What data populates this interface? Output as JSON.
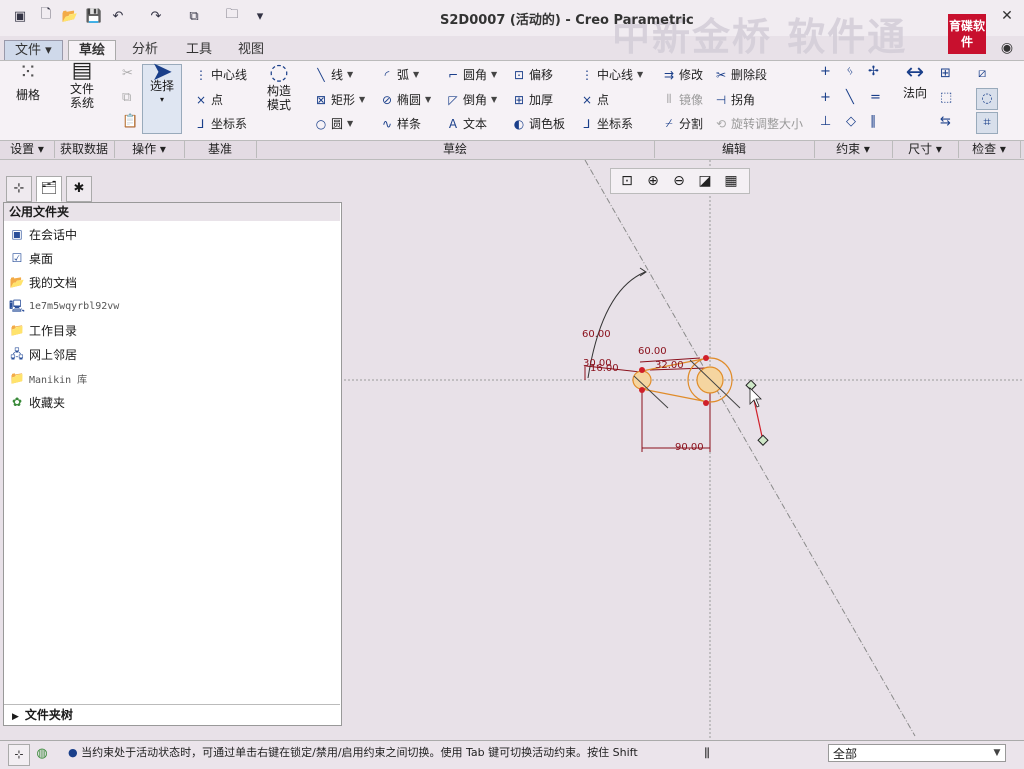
{
  "window": {
    "title": "S2D0007 (活动的) - Creo Parametric",
    "watermark": "中新金桥 软件通",
    "logo_text": "育碟软件"
  },
  "menu_tabs": [
    {
      "label": "文件",
      "kind": "file"
    },
    {
      "label": "草绘",
      "kind": "active"
    },
    {
      "label": "分析"
    },
    {
      "label": "工具"
    },
    {
      "label": "视图"
    }
  ],
  "ribbon": {
    "grid_label": "栅格",
    "file_system_label": "文件\n系统",
    "select_label": "选择",
    "datum": {
      "centerline": "中心线",
      "point": "点",
      "coord_sys": "坐标系"
    },
    "construction_label": "构造\n模式",
    "sketch": {
      "line": "线",
      "arc": "弧",
      "fillet": "圆角",
      "offset": "偏移",
      "rectangle": "矩形",
      "ellipse": "椭圆",
      "chamfer": "倒角",
      "thicken": "加厚",
      "circle": "圆",
      "spline": "样条",
      "text": "文本",
      "palette": "调色板",
      "centerline": "中心线",
      "point": "点",
      "coord_sys": "坐标系"
    },
    "edit": {
      "modify": "修改",
      "delete_segment": "删除段",
      "mirror": "镜像",
      "corner": "拐角",
      "divide": "分割",
      "rotate_resize": "旋转调整大小"
    },
    "normal_label": "法向"
  },
  "groups": {
    "setup": "设置",
    "get_data": "获取数据",
    "operations": "操作",
    "datum": "基准",
    "sketching": "草绘",
    "editing": "编辑",
    "constrain": "约束",
    "dimension": "尺寸",
    "inspect": "检查"
  },
  "folder_panel": {
    "header": "公用文件夹",
    "items": [
      {
        "label": "在会话中",
        "icon": "session-icon"
      },
      {
        "label": "桌面",
        "icon": "desktop-icon"
      },
      {
        "label": "我的文档",
        "icon": "documents-icon"
      },
      {
        "label": "1e7m5wqyrbl92vw",
        "icon": "computer-icon",
        "mono": true
      },
      {
        "label": "工作目录",
        "icon": "working-dir-icon"
      },
      {
        "label": "网上邻居",
        "icon": "network-icon"
      },
      {
        "label": "Manikin 库",
        "icon": "library-icon",
        "mono": true
      },
      {
        "label": "收藏夹",
        "icon": "favorites-icon"
      }
    ],
    "tree_label": "文件夹树"
  },
  "sketch_dims": {
    "angle_top": "60.00",
    "d30": "30.00",
    "d16": "16.00",
    "d60": "60.00",
    "d32": "32.00",
    "d90": "90.00"
  },
  "status": {
    "message": "当约束处于活动状态时，可通过单击右键在锁定/禁用/启用约束之间切换。使用 Tab 键可切换活动约束。按住 Shift",
    "filter_value": "全部"
  }
}
